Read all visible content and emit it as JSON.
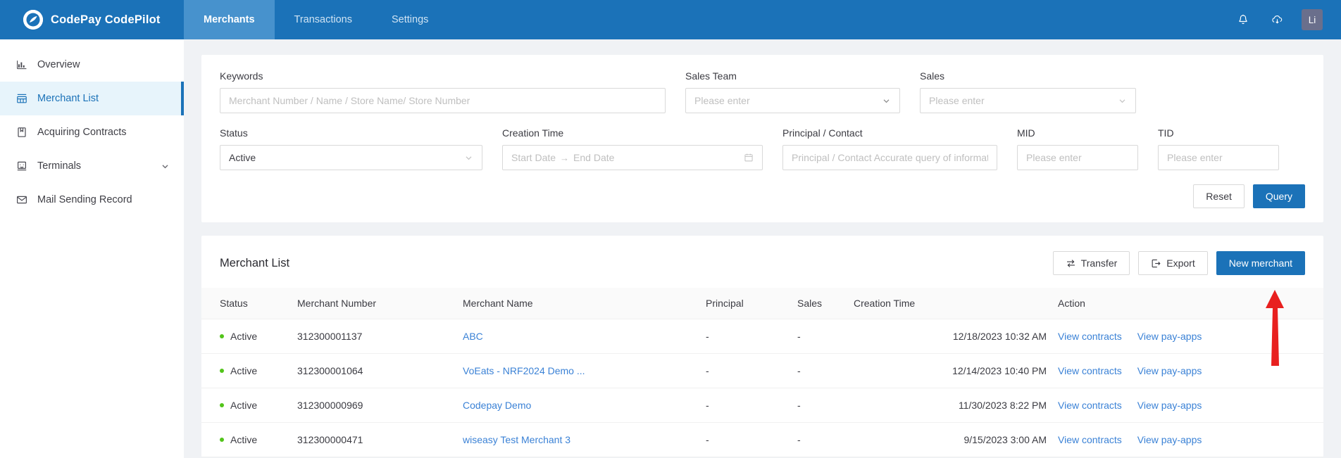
{
  "brand": {
    "name": "CodePay CodePilot",
    "logo_icon": "speedometer-logo-icon"
  },
  "topnav": {
    "items": [
      {
        "label": "Merchants",
        "active": true
      },
      {
        "label": "Transactions",
        "active": false
      },
      {
        "label": "Settings",
        "active": false
      }
    ],
    "icons": [
      {
        "name": "bell-icon"
      },
      {
        "name": "cloud-download-icon"
      }
    ],
    "avatar": "Li"
  },
  "sidebar": {
    "items": [
      {
        "label": "Overview",
        "icon": "bar-chart-icon",
        "active": false,
        "caret": false
      },
      {
        "label": "Merchant List",
        "icon": "shop-icon",
        "active": true,
        "caret": false
      },
      {
        "label": "Acquiring Contracts",
        "icon": "contract-icon",
        "active": false,
        "caret": false
      },
      {
        "label": "Terminals",
        "icon": "terminal-device-icon",
        "active": false,
        "caret": true
      },
      {
        "label": "Mail Sending Record",
        "icon": "mail-icon",
        "active": false,
        "caret": false
      }
    ]
  },
  "filters": {
    "keywords": {
      "label": "Keywords",
      "placeholder": "Merchant Number / Name / Store Name/ Store Number",
      "value": ""
    },
    "sales_team": {
      "label": "Sales Team",
      "placeholder": "Please enter",
      "value": ""
    },
    "sales": {
      "label": "Sales",
      "placeholder": "Please enter",
      "value": ""
    },
    "status": {
      "label": "Status",
      "value": "Active",
      "options": [
        "Active"
      ]
    },
    "creation_time": {
      "label": "Creation Time",
      "start_placeholder": "Start Date",
      "end_placeholder": "End Date",
      "separator": "→"
    },
    "principal": {
      "label": "Principal / Contact",
      "placeholder": "Principal / Contact Accurate query of information",
      "value": ""
    },
    "mid": {
      "label": "MID",
      "placeholder": "Please enter",
      "value": ""
    },
    "tid": {
      "label": "TID",
      "placeholder": "Please enter",
      "value": ""
    },
    "reset_label": "Reset",
    "query_label": "Query"
  },
  "list": {
    "title": "Merchant List",
    "transfer_label": "Transfer",
    "export_label": "Export",
    "new_merchant_label": "New merchant",
    "columns": [
      "Status",
      "Merchant Number",
      "Merchant Name",
      "Principal",
      "Sales",
      "Creation Time",
      "Action"
    ],
    "action_labels": {
      "view_contracts": "View contracts",
      "view_pay_apps": "View pay-apps"
    },
    "rows": [
      {
        "status": "Active",
        "merchant_number": "312300001137",
        "merchant_name": "ABC",
        "principal": "-",
        "sales": "-",
        "creation_time": "12/18/2023 10:32 AM"
      },
      {
        "status": "Active",
        "merchant_number": "312300001064",
        "merchant_name": "VoEats - NRF2024 Demo ...",
        "principal": "-",
        "sales": "-",
        "creation_time": "12/14/2023 10:40 PM"
      },
      {
        "status": "Active",
        "merchant_number": "312300000969",
        "merchant_name": "Codepay Demo",
        "principal": "-",
        "sales": "-",
        "creation_time": "11/30/2023 8:22 PM"
      },
      {
        "status": "Active",
        "merchant_number": "312300000471",
        "merchant_name": "wiseasy Test Merchant 3",
        "principal": "-",
        "sales": "-",
        "creation_time": "9/15/2023 3:00 AM"
      }
    ]
  },
  "annotation": {
    "arrow_color": "#e8201f",
    "points_to": "New merchant"
  },
  "colors": {
    "brand_blue": "#1b72b8",
    "active_tab": "#4792cd",
    "sidebar_active_bg": "#e7f4fb",
    "link_blue": "#3b82d6",
    "status_green": "#52c41a",
    "page_bg": "#f0f2f5"
  }
}
